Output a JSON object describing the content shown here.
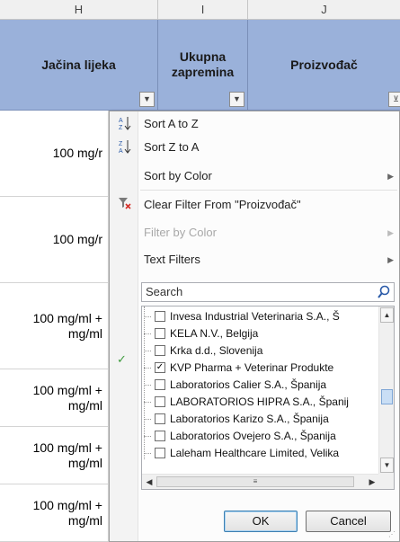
{
  "columns": {
    "h": "H",
    "i": "I",
    "j": "J"
  },
  "headers": {
    "h": "Jačina lijeka",
    "i_line1": "Ukupna",
    "i_line2": "zapremina",
    "j": "Proizvođač"
  },
  "cells": [
    {
      "line1": "100 mg/r",
      "line2": ""
    },
    {
      "line1": "100 mg/r",
      "line2": ""
    },
    {
      "line1": "100 mg/ml +",
      "line2": "mg/ml"
    },
    {
      "line1": "100 mg/ml +",
      "line2": "mg/ml"
    },
    {
      "line1": "100 mg/ml +",
      "line2": "mg/ml"
    },
    {
      "line1": "100 mg/ml +",
      "line2": "mg/ml"
    }
  ],
  "menu": {
    "sort_az": "Sort A to Z",
    "sort_za": "Sort Z to A",
    "sort_color": "Sort by Color",
    "clear_filter": "Clear Filter From \"Proizvođač\"",
    "filter_color": "Filter by Color",
    "text_filters": "Text Filters",
    "search_placeholder": "Search",
    "ok": "OK",
    "cancel": "Cancel"
  },
  "filter_items": [
    {
      "label": "Invesa Industrial Veterinaria S.A., Š",
      "checked": false
    },
    {
      "label": "KELA N.V., Belgija",
      "checked": false
    },
    {
      "label": "Krka d.d., Slovenija",
      "checked": false
    },
    {
      "label": "KVP Pharma + Veterinar Produkte",
      "checked": true
    },
    {
      "label": "Laboratorios Calier S.A., Španija",
      "checked": false
    },
    {
      "label": "LABORATORIOS HIPRA S.A., Španij",
      "checked": false
    },
    {
      "label": "Laboratorios Karizo S.A., Španija",
      "checked": false
    },
    {
      "label": "Laboratorios Ovejero S.A., Španija",
      "checked": false
    },
    {
      "label": "Laleham Healthcare Limited, Velika",
      "checked": false
    }
  ],
  "colors": {
    "header_fill": "#9ab1da",
    "accent": "#3c7fb1"
  },
  "icons": [
    "sort-az-icon",
    "sort-za-icon",
    "clear-filter-icon",
    "search-icon",
    "filter-dropdown-icon"
  ]
}
